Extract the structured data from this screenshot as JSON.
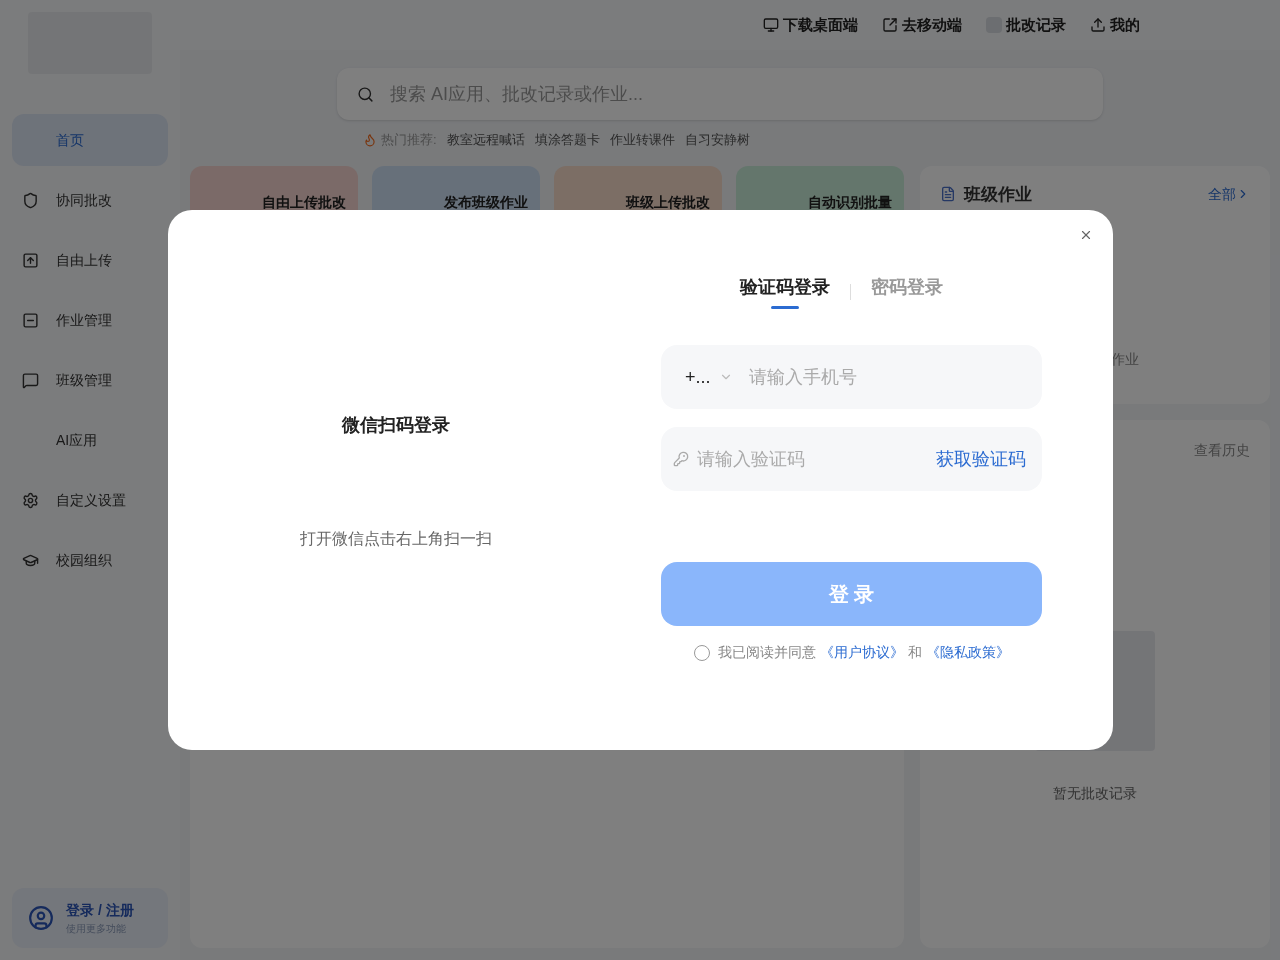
{
  "sidebar": {
    "items": [
      {
        "label": "首页",
        "selected": true
      },
      {
        "label": "协同批改",
        "selected": false
      },
      {
        "label": "自由上传",
        "selected": false
      },
      {
        "label": "作业管理",
        "selected": false
      },
      {
        "label": "班级管理",
        "selected": false
      },
      {
        "label": "AI应用",
        "selected": false
      },
      {
        "label": "自定义设置",
        "selected": false
      },
      {
        "label": "校园组织",
        "selected": false
      }
    ],
    "account": {
      "title": "登录 / 注册",
      "subtitle": "使用更多功能"
    }
  },
  "top_nav": [
    "下载桌面端",
    "去移动端",
    "批改记录",
    "我的"
  ],
  "search": {
    "placeholder": "搜索 AI应用、批改记录或作业..."
  },
  "hot": {
    "label": "热门推荐:",
    "items": [
      "教室远程喊话",
      "填涂答题卡",
      "作业转课件",
      "自习安静树"
    ]
  },
  "quick_cards": [
    {
      "label": "自由上传批改"
    },
    {
      "label": "发布班级作业"
    },
    {
      "label": "班级上传批改"
    },
    {
      "label": "自动识别批量"
    }
  ],
  "class_homework": {
    "title": "班级作业",
    "more": "全部",
    "empty": "作业"
  },
  "history": {
    "more": "查看历史",
    "empty": "暂无批改记录"
  },
  "login_dialog": {
    "wechat_title": "微信扫码登录",
    "wechat_hint": "打开微信点击右上角扫一扫",
    "tabs": [
      {
        "label": "验证码登录",
        "selected": true
      },
      {
        "label": "密码登录",
        "selected": false
      }
    ],
    "country_code": "+...",
    "phone": {
      "placeholder": "请输入手机号"
    },
    "code": {
      "placeholder": "请输入验证码"
    },
    "get_code": "获取验证码",
    "submit": {
      "label": "登 录",
      "disabled": true
    },
    "agreement": {
      "checked": false,
      "text": "我已阅读并同意",
      "link1": "《用户协议》",
      "and": "和",
      "link2": "《隐私政策》"
    }
  }
}
